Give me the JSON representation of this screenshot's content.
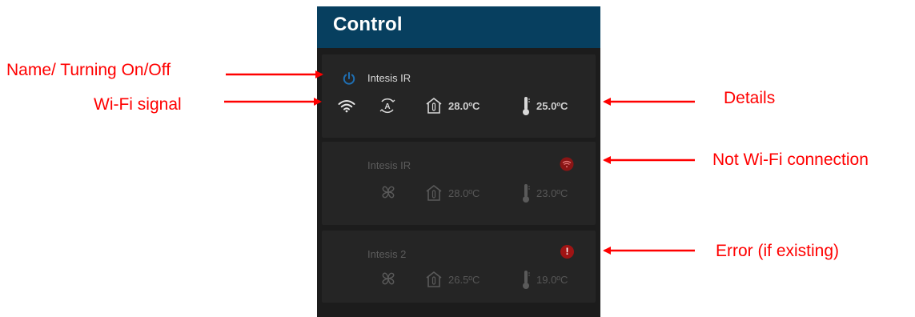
{
  "panel": {
    "title": "Control",
    "header_color": "#073f5f",
    "background_color": "#1c1c1c"
  },
  "devices": [
    {
      "name": "Intesis IR",
      "status": "active",
      "leading_icon": "power-icon",
      "status_icon": "wifi-icon",
      "mode_icon": "auto-mode-icon",
      "room_temp": "28.0ºC",
      "set_temp": "25.0ºC"
    },
    {
      "name": "Intesis IR",
      "status": "no-wifi",
      "badge_icon": "wifi-off-icon",
      "mode_icon": "fan-icon",
      "room_temp": "28.0ºC",
      "set_temp": "23.0ºC"
    },
    {
      "name": "Intesis 2",
      "status": "error",
      "badge_icon": "error-icon",
      "badge_symbol": "!",
      "mode_icon": "fan-icon",
      "room_temp": "26.5ºC",
      "set_temp": "19.0ºC"
    }
  ],
  "annotations": {
    "name_power": "Name/ Turning On/Off",
    "wifi_signal": "Wi-Fi signal",
    "details": "Details",
    "no_wifi": "Not Wi-Fi connection",
    "error": "Error (if existing)"
  },
  "colors": {
    "annotation": "#ff0000",
    "power_icon": "#1f6fb3",
    "alert_badge": "#a01414"
  }
}
